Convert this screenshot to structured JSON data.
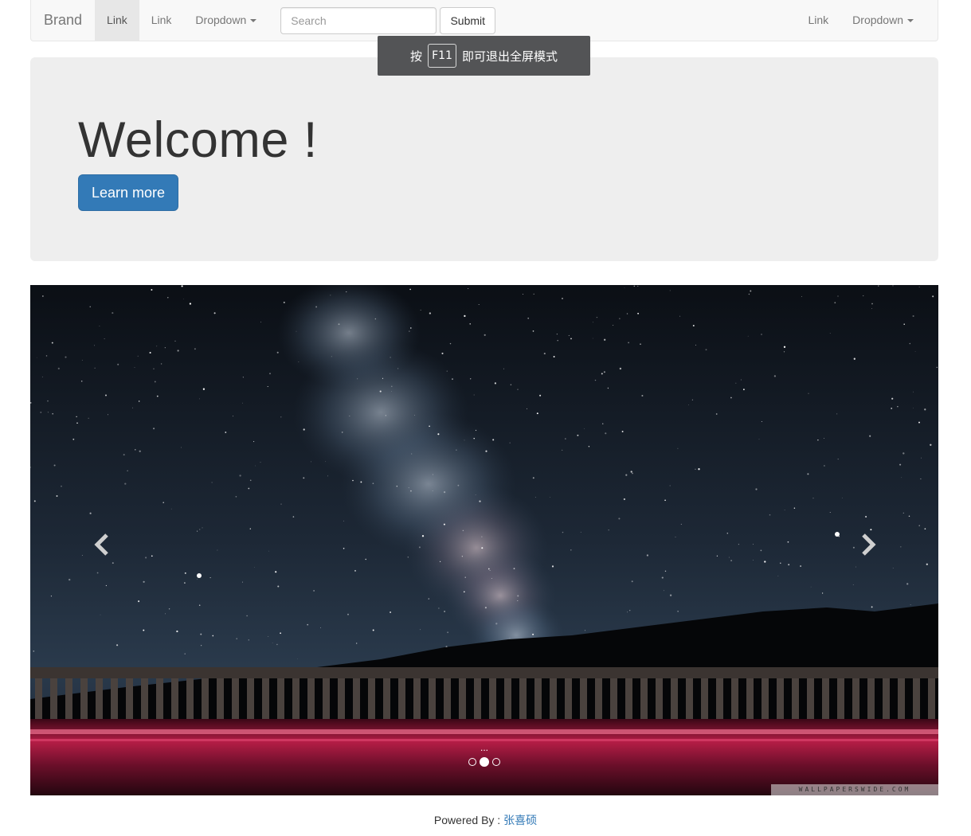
{
  "navbar": {
    "brand": "Brand",
    "links_left": [
      "Link",
      "Link"
    ],
    "dropdown_left": "Dropdown",
    "search": {
      "placeholder": "Search",
      "value": ""
    },
    "submit_label": "Submit",
    "link_right": "Link",
    "dropdown_right": "Dropdown"
  },
  "toast": {
    "prefix": "按",
    "key": "F11",
    "suffix": "即可退出全屏模式"
  },
  "jumbotron": {
    "heading": "Welcome !",
    "button_label": "Learn more"
  },
  "carousel": {
    "caption": "...",
    "slide_count": 3,
    "active_index": 1,
    "watermark": "WALLPAPERSWIDE.COM"
  },
  "footer": {
    "text": "Powered By : ",
    "author": "张喜硕"
  },
  "colors": {
    "primary": "#337ab7",
    "navbar_bg": "#f8f8f8",
    "jumbotron_bg": "#eeeeee"
  }
}
